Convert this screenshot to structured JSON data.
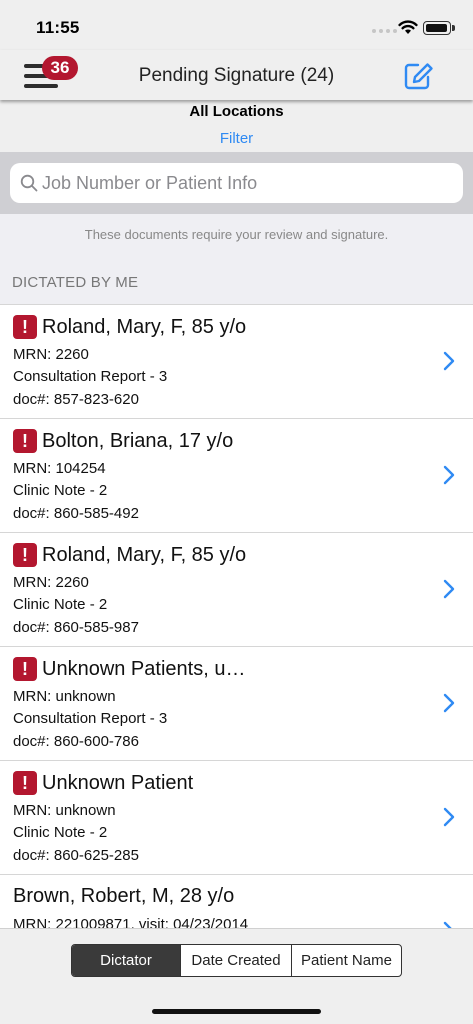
{
  "status": {
    "time": "11:55"
  },
  "nav": {
    "badge_count": "36",
    "title": "Pending Signature (24)"
  },
  "locations": {
    "title": "All Locations",
    "filter_label": "Filter"
  },
  "search": {
    "placeholder": "Job Number or Patient Info"
  },
  "info_text": "These documents require your review and signature.",
  "section_header": "DICTATED BY ME",
  "documents": [
    {
      "name": "Roland, Mary, F, 85 y/o",
      "mrn": "MRN: 2260",
      "type": "Consultation Report - 3",
      "doc": "doc#: 857-823-620",
      "flagged": true
    },
    {
      "name": "Bolton, Briana, 17 y/o",
      "mrn": "MRN: 104254",
      "type": "Clinic Note - 2",
      "doc": "doc#: 860-585-492",
      "flagged": true
    },
    {
      "name": "Roland, Mary, F, 85 y/o",
      "mrn": "MRN: 2260",
      "type": "Clinic Note - 2",
      "doc": "doc#: 860-585-987",
      "flagged": true
    },
    {
      "name": "Unknown Patients, u…",
      "mrn": "MRN: unknown",
      "type": "Consultation Report - 3",
      "doc": "doc#: 860-600-786",
      "flagged": true
    },
    {
      "name": "Unknown Patient",
      "mrn": "MRN: unknown",
      "type": "Clinic Note - 2",
      "doc": "doc#: 860-625-285",
      "flagged": true
    },
    {
      "name": "Brown, Robert, M, 28 y/o",
      "mrn": "MRN: 221009871, visit: 04/23/2014",
      "flagged": false
    }
  ],
  "sort_tabs": {
    "dictator": "Dictator",
    "date_created": "Date Created",
    "patient_name": "Patient Name",
    "active": "Dictator"
  },
  "colors": {
    "accent": "#2f8af3",
    "alert": "#b3172f",
    "segment_active": "#3a3a3a"
  }
}
